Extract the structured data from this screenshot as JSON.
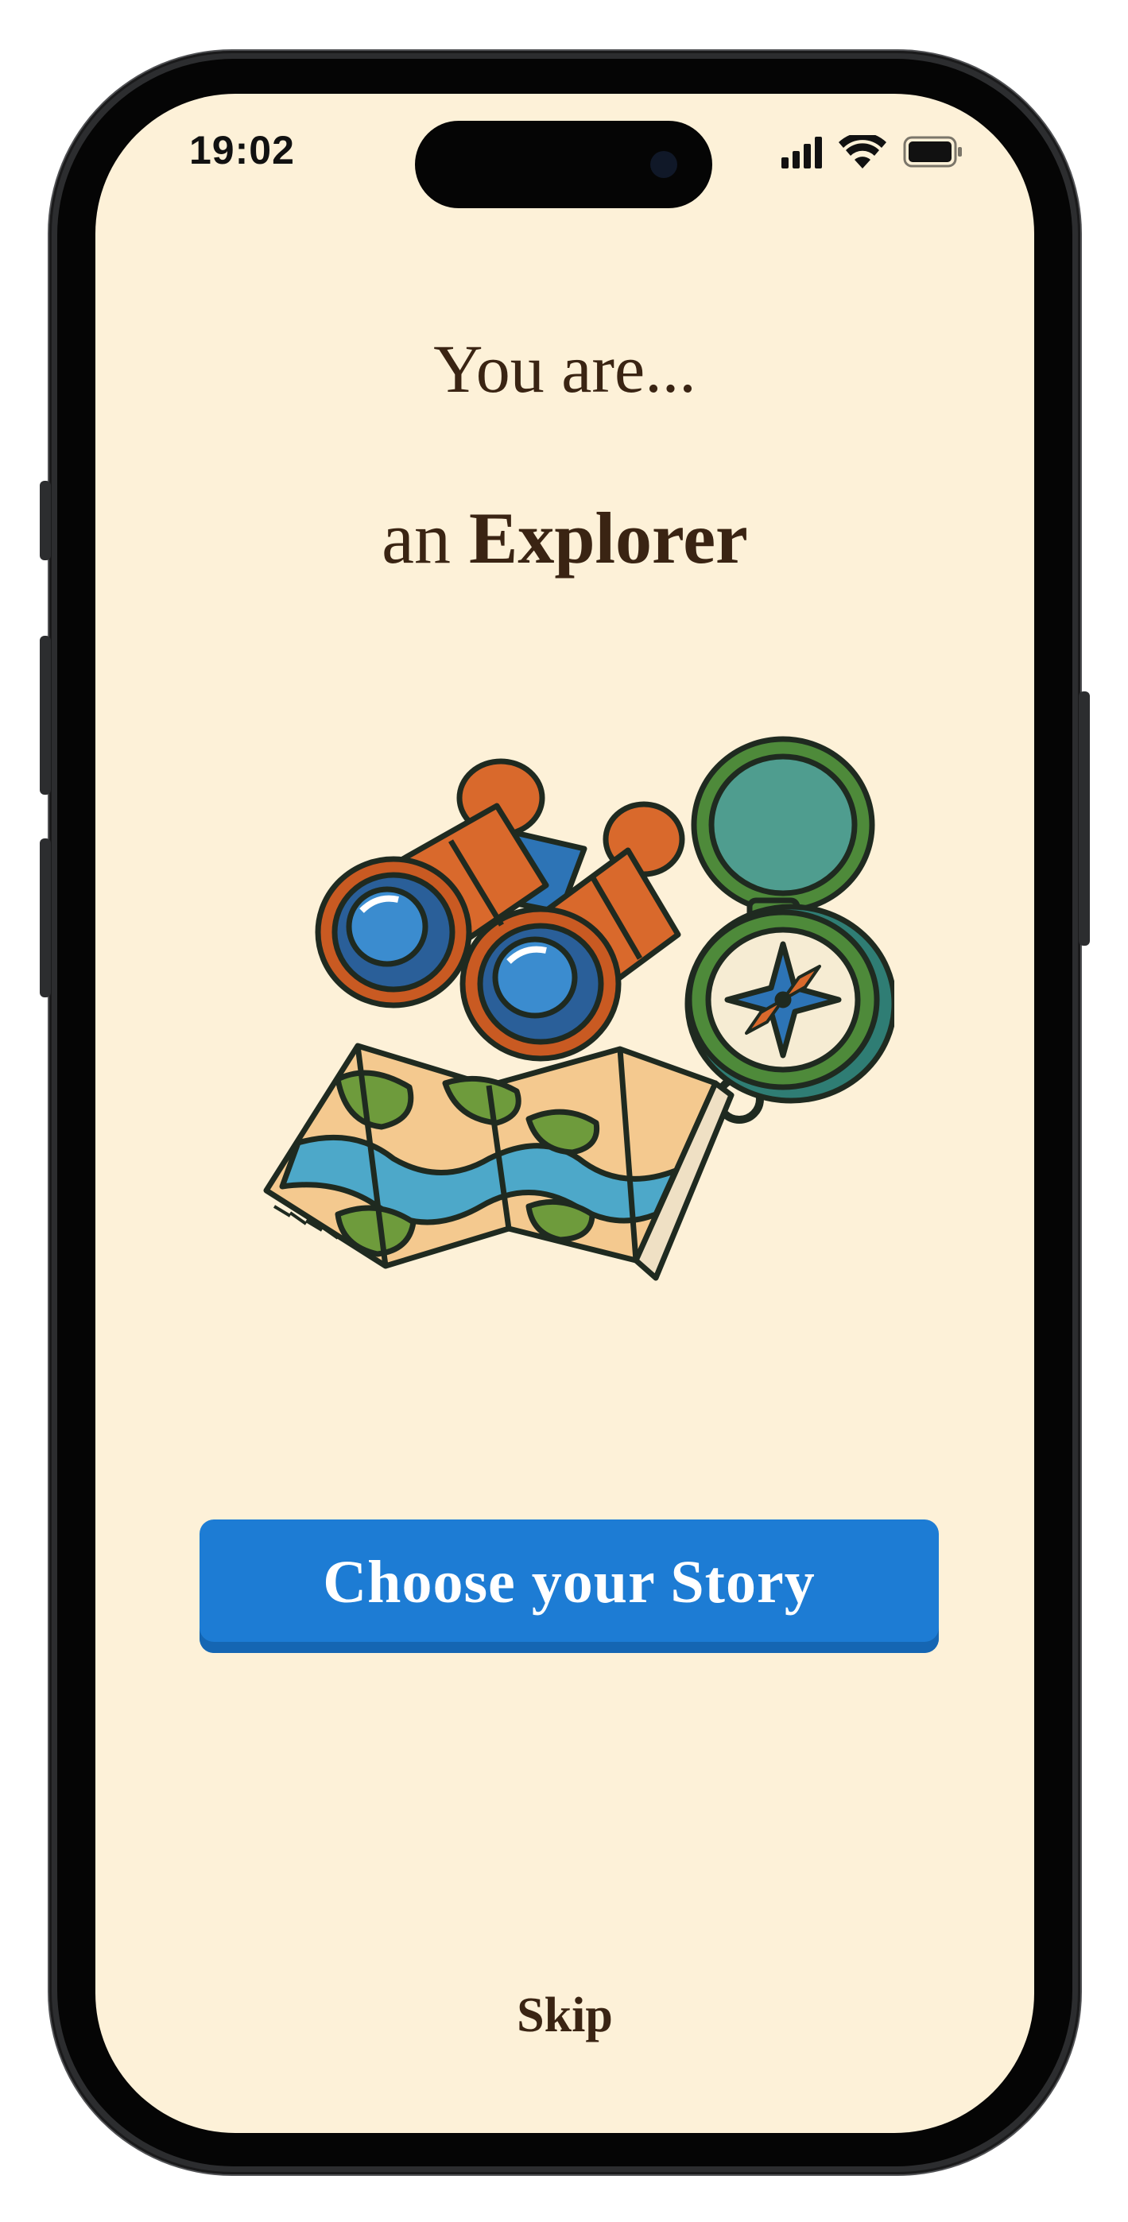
{
  "status_bar": {
    "time": "19:02"
  },
  "onboarding": {
    "intro": "You are...",
    "role_prefix": "an",
    "role": "Explorer"
  },
  "illustration_items": [
    "binoculars",
    "compass",
    "map"
  ],
  "cta": {
    "label": "Choose your Story"
  },
  "skip": {
    "label": "Skip"
  },
  "colors": {
    "background": "#fdf1d8",
    "text": "#3a2413",
    "button": "#1d7cd4"
  }
}
